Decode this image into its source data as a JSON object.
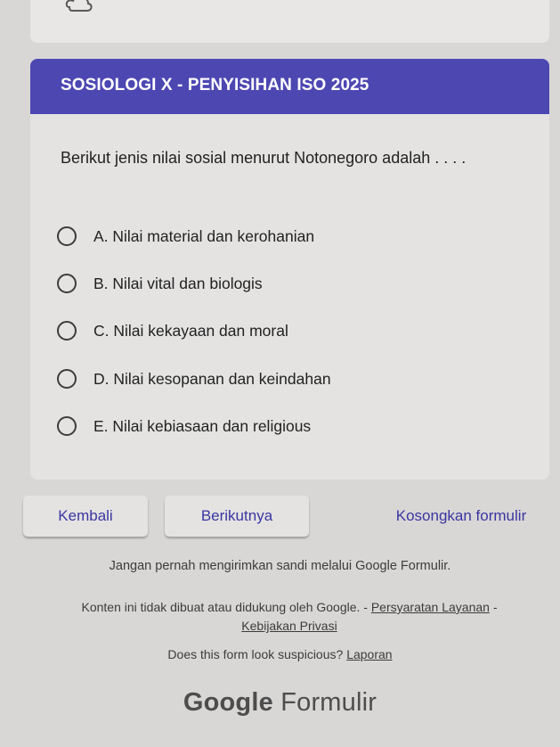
{
  "header": {
    "title": "SOSIOLOGI X  - PENYISIHAN ISO 2025"
  },
  "question": {
    "text": "Berikut jenis nilai sosial menurut Notonegoro adalah . . . .",
    "options": [
      "A. Nilai material dan kerohanian",
      "B. Nilai vital dan biologis",
      "C. Nilai kekayaan dan moral",
      "D. Nilai kesopanan dan keindahan",
      "E. Nilai kebiasaan dan religious"
    ]
  },
  "nav": {
    "back_label": "Kembali",
    "next_label": "Berikutnya",
    "clear_label": "Kosongkan formulir"
  },
  "footer": {
    "warning": "Jangan pernah mengirimkan sandi melalui Google Formulir.",
    "terms_prefix": "Konten ini tidak dibuat atau didukung oleh Google. -",
    "terms_link": "Persyaratan Layanan",
    "terms_sep": "-",
    "privacy_link": "Kebijakan Privasi",
    "report_text": "Does this form look suspicious?",
    "report_link": "Laporan",
    "brand_google": "Google",
    "brand_forms": "Formulir"
  },
  "icons": {
    "top": "cloud-icon"
  },
  "colors": {
    "accent": "#4d47b2",
    "button_text": "#3a36a0"
  }
}
